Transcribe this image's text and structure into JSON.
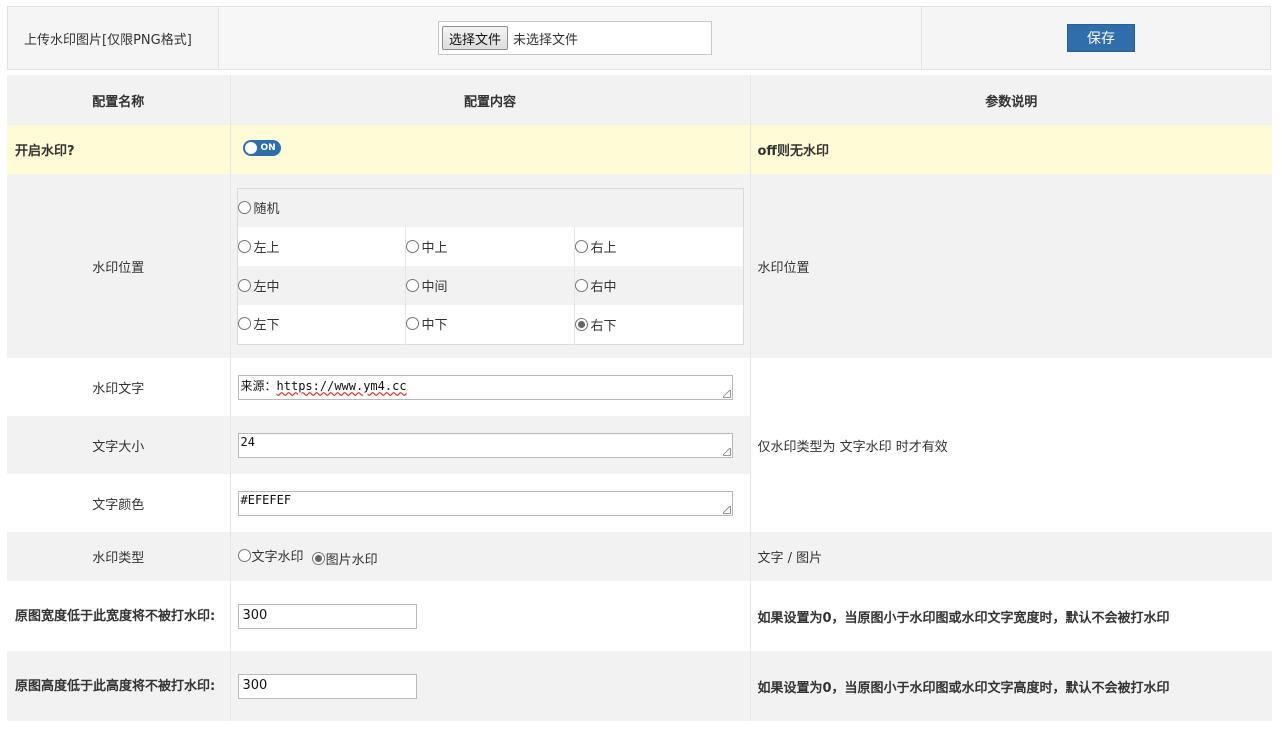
{
  "upload": {
    "label": "上传水印图片[仅限PNG格式]",
    "file_button": "选择文件",
    "file_status": "未选择文件",
    "save_button": "保存"
  },
  "table": {
    "headers": [
      "配置名称",
      "配置内容",
      "参数说明"
    ],
    "enable": {
      "label": "开启水印?",
      "toggle_text": "ON",
      "desc": "off则无水印"
    },
    "position": {
      "label": "水印位置",
      "random": "随机",
      "options": [
        "左上",
        "中上",
        "右上",
        "左中",
        "中间",
        "右中",
        "左下",
        "中下",
        "右下"
      ],
      "selected": "右下",
      "desc": "水印位置"
    },
    "text": {
      "label": "水印文字",
      "value_prefix": "来源：",
      "value_url": "https://www.ym4.cc"
    },
    "font_size": {
      "label": "文字大小",
      "value": "24"
    },
    "font_color": {
      "label": "文字颜色",
      "value": "#EFEFEF"
    },
    "text_desc": "仅水印类型为 文字水印 时才有效",
    "type": {
      "label": "水印类型",
      "option_text": "文字水印",
      "option_image": "图片水印",
      "selected": "图片水印",
      "desc": "文字 / 图片"
    },
    "min_width": {
      "label": "原图宽度低于此宽度将不被打水印:",
      "value": "300",
      "desc": "如果设置为0，当原图小于水印图或水印文字宽度时，默认不会被打水印"
    },
    "min_height": {
      "label": "原图高度低于此高度将不被打水印:",
      "value": "300",
      "desc": "如果设置为0，当原图小于水印图或水印文字高度时，默认不会被打水印"
    }
  },
  "colors": {
    "accent": "#2f6eab",
    "highlight_row": "#fffbd6",
    "stripe": "#f2f2f2"
  }
}
